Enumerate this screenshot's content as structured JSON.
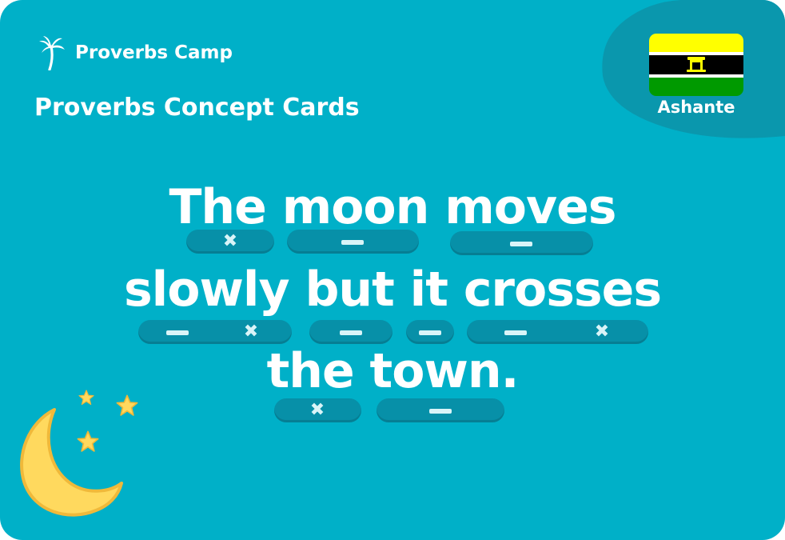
{
  "brand": {
    "name": "Proverbs Camp",
    "logo_icon": "palm-tree-icon"
  },
  "card": {
    "title": "Proverbs Concept Cards"
  },
  "culture": {
    "name": "Ashante",
    "flag_icon": "ashante-flag-icon",
    "flag_colors": [
      "#ffff00",
      "#000000",
      "#ffffff",
      "#009a00"
    ]
  },
  "proverb": {
    "lines": [
      "The moon moves",
      "slowly but it crosses",
      "the town."
    ],
    "markers": [
      "x",
      "-",
      "-",
      "-",
      "x",
      "-",
      "-",
      "-",
      "x",
      "x",
      "-"
    ]
  },
  "decoration": {
    "moon_icon": "crescent-moon-icon",
    "star_icon": "star-icon",
    "moon_color": "#ffd95e"
  },
  "colors": {
    "background": "#00b0c8",
    "corner": "#0a97ad",
    "pill": "#0790a8",
    "text": "#ffffff"
  }
}
